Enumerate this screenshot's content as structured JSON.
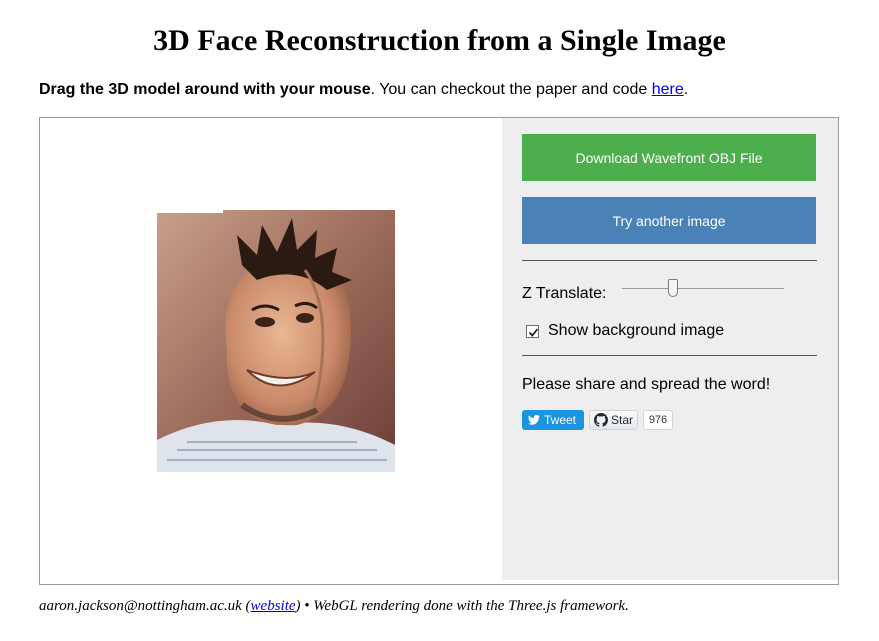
{
  "header": {
    "title": "3D Face Reconstruction from a Single Image"
  },
  "intro": {
    "bold_text": "Drag the 3D model around with your mouse",
    "text": ". You can checkout the paper and code ",
    "link_label": "here",
    "end": "."
  },
  "viewer": {
    "image_icon": "face-reconstruction-render"
  },
  "panel": {
    "download_label": "Download Wavefront OBJ File",
    "try_label": "Try another image",
    "z_translate_label": "Z Translate:",
    "z_translate_value": 0.3,
    "show_background_label": "Show background image",
    "show_background_checked": true,
    "share_text": "Please share and spread the word!",
    "tweet_label": "Tweet",
    "star_label": "Star",
    "star_count": "976"
  },
  "footer": {
    "email": "aaron.jackson@nottingham.ac.uk (",
    "website_label": "website",
    "rest": ") • WebGL rendering done with the Three.js framework."
  },
  "colors": {
    "download_button": "#4cae4c",
    "try_button": "#4a82b7",
    "panel_bg": "#eeeeee",
    "tweet_button": "#1b95e0",
    "link": "#0000ee"
  }
}
